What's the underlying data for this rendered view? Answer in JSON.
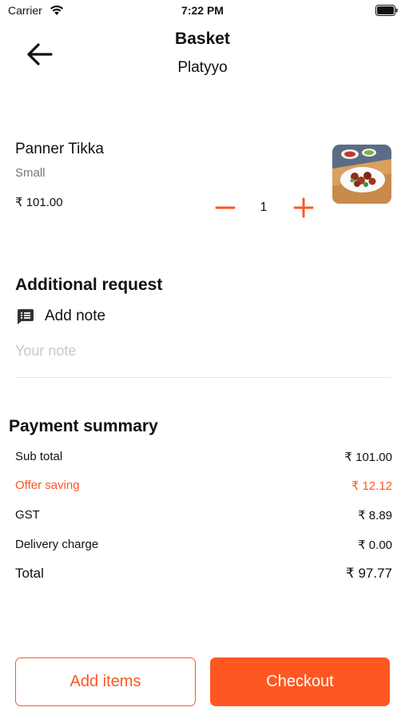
{
  "status_bar": {
    "carrier": "Carrier",
    "time": "7:22 PM"
  },
  "nav": {
    "title": "Basket",
    "subtitle": "Platyyo",
    "back_icon": "arrow-left-icon"
  },
  "item": {
    "name": "Panner Tikka",
    "size": "Small",
    "price": "₹ 101.00",
    "quantity": "1",
    "thumbnail": "food-image"
  },
  "additional_request": {
    "title": "Additional request",
    "add_note_label": "Add note",
    "note_placeholder": "Your note",
    "note_icon": "note-icon"
  },
  "payment_summary": {
    "title": "Payment summary",
    "rows": [
      {
        "label": "Sub total",
        "value": "₹ 101.00"
      },
      {
        "label": "Offer saving",
        "value": "₹ 12.12"
      },
      {
        "label": "GST",
        "value": "₹ 8.89"
      },
      {
        "label": "Delivery charge",
        "value": "₹ 0.00"
      },
      {
        "label": "Total",
        "value": "₹ 97.77"
      }
    ]
  },
  "actions": {
    "add_items": "Add items",
    "checkout": "Checkout"
  },
  "colors": {
    "accent": "#ff5722",
    "muted": "#777777",
    "placeholder": "#c8c8c8"
  }
}
